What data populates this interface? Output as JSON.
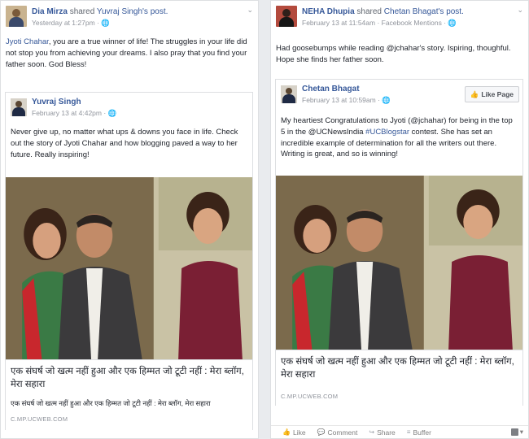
{
  "left_post": {
    "author": "Dia Mirza",
    "verb": "shared",
    "target": "Yuvraj Singh's post.",
    "timestamp": "Yesterday at 1:27pm",
    "privacy_icon": "globe-icon",
    "text_mention": "Jyoti Chahar",
    "text": ", you are a true winner of life! The struggles in your life did not stop you from achieving your dreams. I also pray that you find your father soon. God Bless!",
    "shared": {
      "author": "Yuvraj Singh",
      "timestamp": "February 13 at 4:42pm",
      "text": "Never give up, no matter what ups & downs you face in life. Check out the story of Jyoti Chahar and how blogging paved a way to her future. Really inspiring!",
      "link_title": "एक संघर्ष जो खत्म नहीं हुआ और एक हिम्मत जो टूटी नहीं : मेरा ब्लॉग, मेरा सहारा",
      "link_desc": "एक संघर्ष जो खत्म नहीं हुआ और एक हिम्मत जो टूटी नहीं : मेरा ब्लॉग, मेरा सहारा",
      "link_domain": "C.MP.UCWEB.COM"
    }
  },
  "right_post": {
    "author": "NEHA Dhupia",
    "verb": "shared",
    "target": "Chetan Bhagat's post.",
    "timestamp": "February 13 at 11:54am · Facebook Mentions",
    "privacy_icon": "globe-icon",
    "text": "Had goosebumps while reading @jchahar's story. Ispiring, thoughful. Hope she finds her father soon.",
    "shared": {
      "author": "Chetan Bhagat",
      "timestamp": "February 13 at 10:59am",
      "like_page_label": "Like Page",
      "text_pre": "My heartiest Congratulations to Jyoti (@jchahar) for being in the top 5 in the @UCNewsIndia ",
      "text_hashtag": "#UCBlogstar",
      "text_post": " contest. She has set an incredible example of determination for all the writers out there. Writing is great, and so is winning!",
      "link_title": "एक संघर्ष जो खत्म नहीं हुआ और एक हिम्मत जो टूटी नहीं : मेरा ब्लॉग, मेरा सहारा",
      "link_domain": "C.MP.UCWEB.COM"
    },
    "actions": {
      "like": "Like",
      "comment": "Comment",
      "share": "Share",
      "buffer": "Buffer"
    }
  },
  "colors": {
    "link_blue": "#365899",
    "meta_gray": "#90949c",
    "border": "#dddfe2"
  }
}
